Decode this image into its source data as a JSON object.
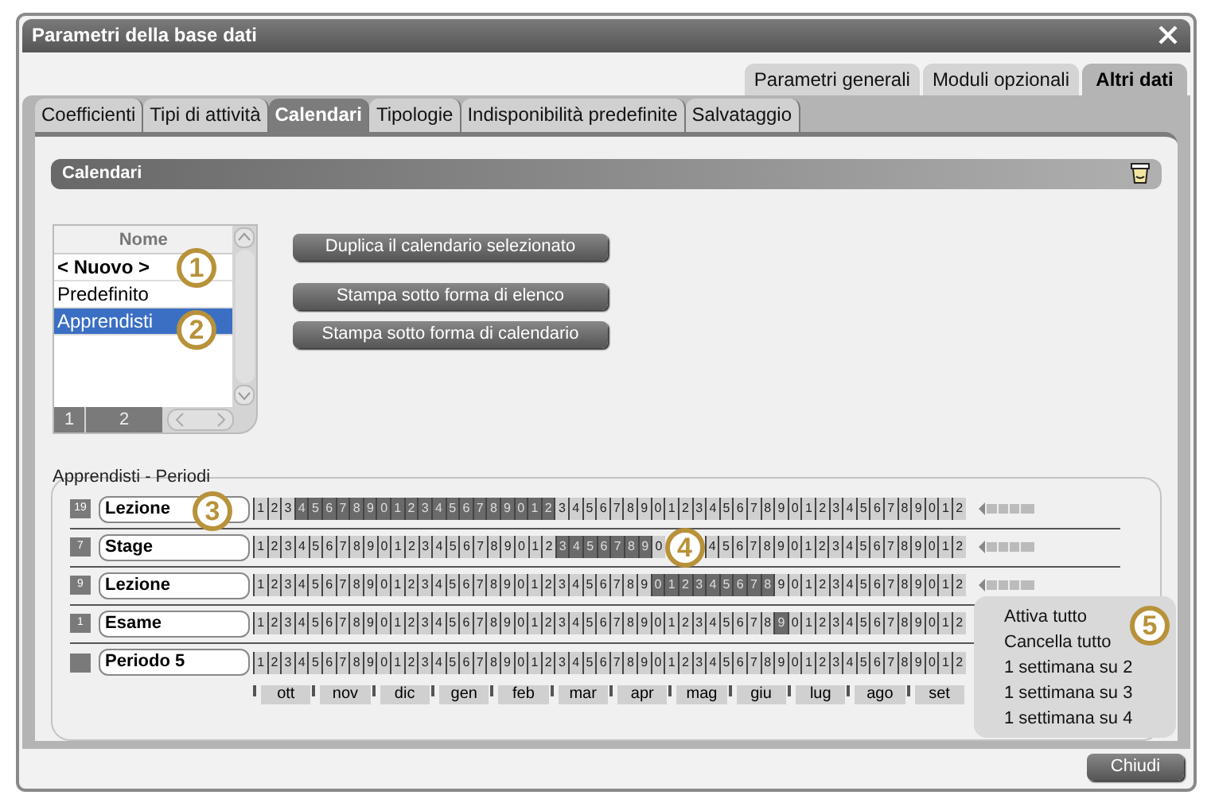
{
  "window": {
    "title": "Parametri della base dati"
  },
  "top_tabs": [
    {
      "label": "Parametri generali",
      "selected": false
    },
    {
      "label": "Moduli opzionali",
      "selected": false
    },
    {
      "label": "Altri dati",
      "selected": true
    }
  ],
  "tabs": [
    {
      "label": "Coefficienti",
      "selected": false
    },
    {
      "label": "Tipi di attività",
      "selected": false
    },
    {
      "label": "Calendari",
      "selected": true
    },
    {
      "label": "Tipologie",
      "selected": false
    },
    {
      "label": "Indisponibilità predefinite",
      "selected": false
    },
    {
      "label": "Salvataggio",
      "selected": false
    }
  ],
  "section": {
    "title": "Calendari"
  },
  "calendar_list": {
    "column": "Nome",
    "items": [
      {
        "label": "< Nuovo >",
        "kind": "new",
        "selected": false
      },
      {
        "label": "Predefinito",
        "kind": "calendar",
        "selected": false
      },
      {
        "label": "Apprendisti",
        "kind": "calendar",
        "selected": true
      }
    ],
    "pages": [
      "1",
      "2"
    ]
  },
  "buttons": [
    "Duplica il calendario selezionato",
    "Stampa sotto forma di elenco",
    "Stampa sotto forma di calendario"
  ],
  "periods": {
    "title": "Apprendisti - Periodi",
    "rows": [
      {
        "count": "19",
        "name": "Lezione",
        "marker": true,
        "weeks": [
          {
            "n": "1",
            "active": false
          },
          {
            "n": "2",
            "active": false
          },
          {
            "n": "3",
            "active": false
          },
          {
            "n": "4",
            "active": true
          },
          {
            "n": "5",
            "active": true
          },
          {
            "n": "6",
            "active": true
          },
          {
            "n": "7",
            "active": true
          },
          {
            "n": "8",
            "active": true
          },
          {
            "n": "9",
            "active": true
          },
          {
            "n": "0",
            "active": true
          },
          {
            "n": "1",
            "active": true
          },
          {
            "n": "2",
            "active": true
          },
          {
            "n": "3",
            "active": true
          },
          {
            "n": "4",
            "active": true
          },
          {
            "n": "5",
            "active": true
          },
          {
            "n": "6",
            "active": true
          },
          {
            "n": "7",
            "active": true
          },
          {
            "n": "8",
            "active": true
          },
          {
            "n": "9",
            "active": true
          },
          {
            "n": "0",
            "active": true
          },
          {
            "n": "1",
            "active": true
          },
          {
            "n": "2",
            "active": true
          },
          {
            "n": "3",
            "active": false
          },
          {
            "n": "4",
            "active": false
          },
          {
            "n": "5",
            "active": false
          },
          {
            "n": "6",
            "active": false
          },
          {
            "n": "7",
            "active": false
          },
          {
            "n": "8",
            "active": false
          },
          {
            "n": "9",
            "active": false
          },
          {
            "n": "0",
            "active": false
          },
          {
            "n": "1",
            "active": false
          },
          {
            "n": "2",
            "active": false
          },
          {
            "n": "3",
            "active": false
          },
          {
            "n": "4",
            "active": false
          },
          {
            "n": "5",
            "active": false
          },
          {
            "n": "6",
            "active": false
          },
          {
            "n": "7",
            "active": false
          },
          {
            "n": "8",
            "active": false
          },
          {
            "n": "9",
            "active": false
          },
          {
            "n": "0",
            "active": false
          },
          {
            "n": "1",
            "active": false
          },
          {
            "n": "2",
            "active": false
          },
          {
            "n": "3",
            "active": false
          },
          {
            "n": "4",
            "active": false
          },
          {
            "n": "5",
            "active": false
          },
          {
            "n": "6",
            "active": false
          },
          {
            "n": "7",
            "active": false
          },
          {
            "n": "8",
            "active": false
          },
          {
            "n": "9",
            "active": false
          },
          {
            "n": "0",
            "active": false
          },
          {
            "n": "1",
            "active": false
          },
          {
            "n": "2",
            "active": false
          }
        ]
      },
      {
        "count": "7",
        "name": "Stage",
        "marker": true,
        "weeks": [
          {
            "n": "1",
            "active": false
          },
          {
            "n": "2",
            "active": false
          },
          {
            "n": "3",
            "active": false
          },
          {
            "n": "4",
            "active": false
          },
          {
            "n": "5",
            "active": false
          },
          {
            "n": "6",
            "active": false
          },
          {
            "n": "7",
            "active": false
          },
          {
            "n": "8",
            "active": false
          },
          {
            "n": "9",
            "active": false
          },
          {
            "n": "0",
            "active": false
          },
          {
            "n": "1",
            "active": false
          },
          {
            "n": "2",
            "active": false
          },
          {
            "n": "3",
            "active": false
          },
          {
            "n": "4",
            "active": false
          },
          {
            "n": "5",
            "active": false
          },
          {
            "n": "6",
            "active": false
          },
          {
            "n": "7",
            "active": false
          },
          {
            "n": "8",
            "active": false
          },
          {
            "n": "9",
            "active": false
          },
          {
            "n": "0",
            "active": false
          },
          {
            "n": "1",
            "active": false
          },
          {
            "n": "2",
            "active": false
          },
          {
            "n": "3",
            "active": true
          },
          {
            "n": "4",
            "active": true
          },
          {
            "n": "5",
            "active": true
          },
          {
            "n": "6",
            "active": true
          },
          {
            "n": "7",
            "active": true
          },
          {
            "n": "8",
            "active": true
          },
          {
            "n": "9",
            "active": true
          },
          {
            "n": "0",
            "active": false
          },
          {
            "kind": "callout",
            "label": "4"
          },
          {
            "n": "4",
            "active": false
          },
          {
            "n": "5",
            "active": false
          },
          {
            "n": "6",
            "active": false
          },
          {
            "n": "7",
            "active": false
          },
          {
            "n": "8",
            "active": false
          },
          {
            "n": "9",
            "active": false
          },
          {
            "n": "0",
            "active": false
          },
          {
            "n": "1",
            "active": false
          },
          {
            "n": "2",
            "active": false
          },
          {
            "n": "3",
            "active": false
          },
          {
            "n": "4",
            "active": false
          },
          {
            "n": "5",
            "active": false
          },
          {
            "n": "6",
            "active": false
          },
          {
            "n": "7",
            "active": false
          },
          {
            "n": "8",
            "active": false
          },
          {
            "n": "9",
            "active": false
          },
          {
            "n": "0",
            "active": false
          },
          {
            "n": "1",
            "active": false
          },
          {
            "n": "2",
            "active": false
          }
        ]
      },
      {
        "count": "9",
        "name": "Lezione",
        "marker": true,
        "weeks": [
          {
            "n": "1",
            "active": false
          },
          {
            "n": "2",
            "active": false
          },
          {
            "n": "3",
            "active": false
          },
          {
            "n": "4",
            "active": false
          },
          {
            "n": "5",
            "active": false
          },
          {
            "n": "6",
            "active": false
          },
          {
            "n": "7",
            "active": false
          },
          {
            "n": "8",
            "active": false
          },
          {
            "n": "9",
            "active": false
          },
          {
            "n": "0",
            "active": false
          },
          {
            "n": "1",
            "active": false
          },
          {
            "n": "2",
            "active": false
          },
          {
            "n": "3",
            "active": false
          },
          {
            "n": "4",
            "active": false
          },
          {
            "n": "5",
            "active": false
          },
          {
            "n": "6",
            "active": false
          },
          {
            "n": "7",
            "active": false
          },
          {
            "n": "8",
            "active": false
          },
          {
            "n": "9",
            "active": false
          },
          {
            "n": "0",
            "active": false
          },
          {
            "n": "1",
            "active": false
          },
          {
            "n": "2",
            "active": false
          },
          {
            "n": "3",
            "active": false
          },
          {
            "n": "4",
            "active": false
          },
          {
            "n": "5",
            "active": false
          },
          {
            "n": "6",
            "active": false
          },
          {
            "n": "7",
            "active": false
          },
          {
            "n": "8",
            "active": false
          },
          {
            "n": "9",
            "active": false
          },
          {
            "n": "0",
            "active": true
          },
          {
            "n": "1",
            "active": true
          },
          {
            "n": "2",
            "active": true
          },
          {
            "n": "3",
            "active": true
          },
          {
            "n": "4",
            "active": true
          },
          {
            "n": "5",
            "active": true
          },
          {
            "n": "6",
            "active": true
          },
          {
            "n": "7",
            "active": true
          },
          {
            "n": "8",
            "active": true
          },
          {
            "n": "9",
            "active": false
          },
          {
            "n": "0",
            "active": false
          },
          {
            "n": "1",
            "active": false
          },
          {
            "n": "2",
            "active": false
          },
          {
            "n": "3",
            "active": false
          },
          {
            "n": "4",
            "active": false
          },
          {
            "n": "5",
            "active": false
          },
          {
            "n": "6",
            "active": false
          },
          {
            "n": "7",
            "active": false
          },
          {
            "n": "8",
            "active": false
          },
          {
            "n": "9",
            "active": false
          },
          {
            "n": "0",
            "active": false
          },
          {
            "n": "1",
            "active": false
          },
          {
            "n": "2",
            "active": false
          }
        ]
      },
      {
        "count": "1",
        "name": "Esame",
        "marker": false,
        "weeks": [
          {
            "n": "1",
            "active": false
          },
          {
            "n": "2",
            "active": false
          },
          {
            "n": "3",
            "active": false
          },
          {
            "n": "4",
            "active": false
          },
          {
            "n": "5",
            "active": false
          },
          {
            "n": "6",
            "active": false
          },
          {
            "n": "7",
            "active": false
          },
          {
            "n": "8",
            "active": false
          },
          {
            "n": "9",
            "active": false
          },
          {
            "n": "0",
            "active": false
          },
          {
            "n": "1",
            "active": false
          },
          {
            "n": "2",
            "active": false
          },
          {
            "n": "3",
            "active": false
          },
          {
            "n": "4",
            "active": false
          },
          {
            "n": "5",
            "active": false
          },
          {
            "n": "6",
            "active": false
          },
          {
            "n": "7",
            "active": false
          },
          {
            "n": "8",
            "active": false
          },
          {
            "n": "9",
            "active": false
          },
          {
            "n": "0",
            "active": false
          },
          {
            "n": "1",
            "active": false
          },
          {
            "n": "2",
            "active": false
          },
          {
            "n": "3",
            "active": false
          },
          {
            "n": "4",
            "active": false
          },
          {
            "n": "5",
            "active": false
          },
          {
            "n": "6",
            "active": false
          },
          {
            "n": "7",
            "active": false
          },
          {
            "n": "8",
            "active": false
          },
          {
            "n": "9",
            "active": false
          },
          {
            "n": "0",
            "active": false
          },
          {
            "n": "1",
            "active": false
          },
          {
            "n": "2",
            "active": false
          },
          {
            "n": "3",
            "active": false
          },
          {
            "n": "4",
            "active": false
          },
          {
            "n": "5",
            "active": false
          },
          {
            "n": "6",
            "active": false
          },
          {
            "n": "7",
            "active": false
          },
          {
            "n": "8",
            "active": false
          },
          {
            "n": "9",
            "active": true
          },
          {
            "n": "0",
            "active": false
          },
          {
            "n": "1",
            "active": false
          },
          {
            "n": "2",
            "active": false
          },
          {
            "n": "3",
            "active": false
          },
          {
            "n": "4",
            "active": false
          },
          {
            "n": "5",
            "active": false
          },
          {
            "n": "6",
            "active": false
          },
          {
            "n": "7",
            "active": false
          },
          {
            "n": "8",
            "active": false
          },
          {
            "n": "9",
            "active": false
          },
          {
            "n": "0",
            "active": false
          },
          {
            "n": "1",
            "active": false
          },
          {
            "n": "2",
            "active": false
          }
        ]
      },
      {
        "name": "Periodo 5",
        "marker": false,
        "weeks": [
          {
            "n": "1",
            "active": false
          },
          {
            "n": "2",
            "active": false
          },
          {
            "n": "3",
            "active": false
          },
          {
            "n": "4",
            "active": false
          },
          {
            "n": "5",
            "active": false
          },
          {
            "n": "6",
            "active": false
          },
          {
            "n": "7",
            "active": false
          },
          {
            "n": "8",
            "active": false
          },
          {
            "n": "9",
            "active": false
          },
          {
            "n": "0",
            "active": false
          },
          {
            "n": "1",
            "active": false
          },
          {
            "n": "2",
            "active": false
          },
          {
            "n": "3",
            "active": false
          },
          {
            "n": "4",
            "active": false
          },
          {
            "n": "5",
            "active": false
          },
          {
            "n": "6",
            "active": false
          },
          {
            "n": "7",
            "active": false
          },
          {
            "n": "8",
            "active": false
          },
          {
            "n": "9",
            "active": false
          },
          {
            "n": "0",
            "active": false
          },
          {
            "n": "1",
            "active": false
          },
          {
            "n": "2",
            "active": false
          },
          {
            "n": "3",
            "active": false
          },
          {
            "n": "4",
            "active": false
          },
          {
            "n": "5",
            "active": false
          },
          {
            "n": "6",
            "active": false
          },
          {
            "n": "7",
            "active": false
          },
          {
            "n": "8",
            "active": false
          },
          {
            "n": "9",
            "active": false
          },
          {
            "n": "0",
            "active": false
          },
          {
            "n": "1",
            "active": false
          },
          {
            "n": "2",
            "active": false
          },
          {
            "n": "3",
            "active": false
          },
          {
            "n": "4",
            "active": false
          },
          {
            "n": "5",
            "active": false
          },
          {
            "n": "6",
            "active": false
          },
          {
            "n": "7",
            "active": false
          },
          {
            "n": "8",
            "active": false
          },
          {
            "n": "9",
            "active": false
          },
          {
            "n": "0",
            "active": false
          },
          {
            "n": "1",
            "active": false
          },
          {
            "n": "2",
            "active": false
          },
          {
            "n": "3",
            "active": false
          },
          {
            "n": "4",
            "active": false
          },
          {
            "n": "5",
            "active": false
          },
          {
            "n": "6",
            "active": false
          },
          {
            "n": "7",
            "active": false
          },
          {
            "n": "8",
            "active": false
          },
          {
            "n": "9",
            "active": false
          },
          {
            "n": "0",
            "active": false
          },
          {
            "n": "1",
            "active": false
          },
          {
            "n": "2",
            "active": false
          }
        ]
      }
    ],
    "months": [
      "ott",
      "nov",
      "dic",
      "gen",
      "feb",
      "mar",
      "apr",
      "mag",
      "giu",
      "lug",
      "ago",
      "set"
    ]
  },
  "context_menu": {
    "items": [
      "Attiva tutto",
      "Cancella tutto",
      "1 settimana su 2",
      "1 settimana su 3",
      "1 settimana su 4"
    ]
  },
  "callouts": [
    "1",
    "2",
    "3",
    "5"
  ],
  "close_button": "Chiudi"
}
